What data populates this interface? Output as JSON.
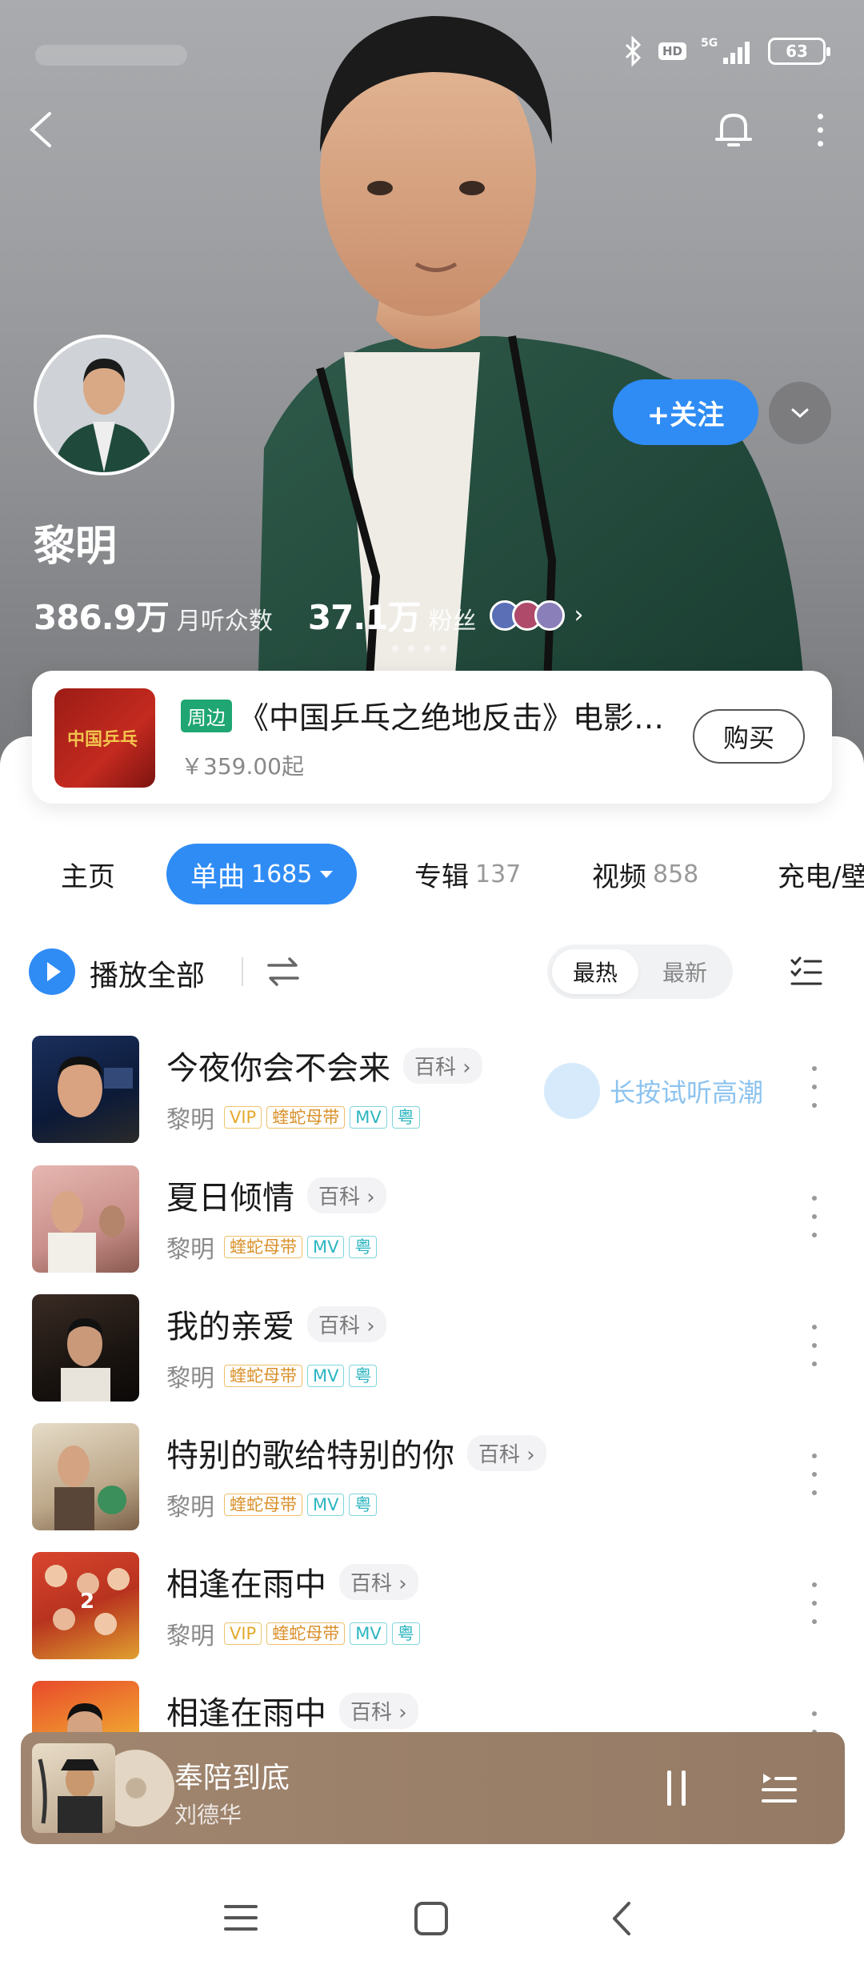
{
  "status_bar": {
    "network": "5G",
    "hd": "HD",
    "battery": "63"
  },
  "artist": {
    "name": "黎明",
    "monthly_listeners": "386.9万",
    "monthly_listeners_label": "月听众数",
    "fans": "37.1万",
    "fans_label": "粉丝",
    "follow_label": "+关注"
  },
  "promo": {
    "tag": "周边",
    "title": "《中国乒乓之绝地反击》电影…",
    "price": "￥359.00起",
    "buy_label": "购买",
    "cover_text": "中国乒乓"
  },
  "tabs": [
    {
      "label": "主页",
      "count": ""
    },
    {
      "label": "单曲",
      "count": "1685"
    },
    {
      "label": "专辑",
      "count": "137"
    },
    {
      "label": "视频",
      "count": "858"
    },
    {
      "label": "充电/壁",
      "count": ""
    }
  ],
  "toolbar": {
    "play_all": "播放全部",
    "sort_hot": "最热",
    "sort_new": "最新"
  },
  "songs": [
    {
      "title": "今夜你会不会来",
      "baike": "百科 ›",
      "artist": "黎明",
      "badges": [
        "VIP",
        "蝰蛇母带",
        "MV",
        "粤"
      ],
      "hint": "长按试听高潮"
    },
    {
      "title": "夏日倾情",
      "baike": "百科 ›",
      "artist": "黎明",
      "badges": [
        "蝰蛇母带",
        "MV",
        "粤"
      ]
    },
    {
      "title": "我的亲爱",
      "baike": "百科 ›",
      "artist": "黎明",
      "badges": [
        "蝰蛇母带",
        "MV",
        "粤"
      ]
    },
    {
      "title": "特别的歌给特别的你",
      "baike": "百科 ›",
      "artist": "黎明",
      "badges": [
        "蝰蛇母带",
        "MV",
        "粤"
      ]
    },
    {
      "title": "相逢在雨中",
      "baike": "百科 ›",
      "artist": "黎明",
      "badges": [
        "VIP",
        "蝰蛇母带",
        "MV",
        "粤"
      ]
    },
    {
      "title": "相逢在雨中",
      "baike": "百科 ›",
      "artist": "",
      "badges": []
    }
  ],
  "mini_player": {
    "title": "奉陪到底",
    "artist": "刘德华"
  },
  "colors": {
    "accent": "#2f8cf5",
    "promo_tag": "#1fa672",
    "player_bg": "#9b8069"
  }
}
